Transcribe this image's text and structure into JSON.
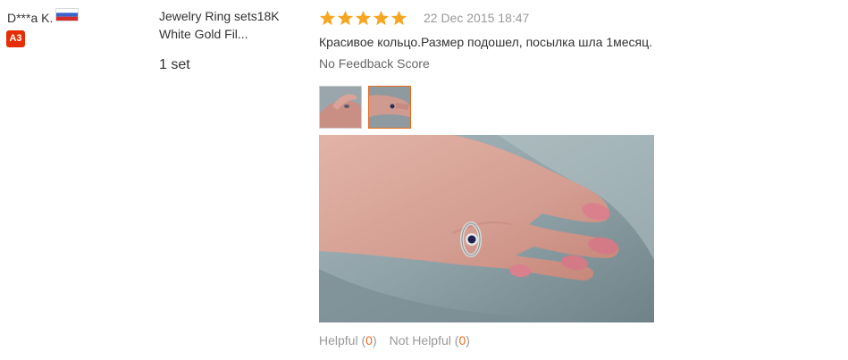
{
  "reviewer": {
    "name": "D***a K.",
    "country_flag": "russia-flag-icon",
    "level_badge": "A3",
    "badge_color": "#e62e04"
  },
  "product": {
    "title_line1": "Jewelry Ring sets18K",
    "title_line2": "White Gold Fil...",
    "quantity": "1 set"
  },
  "review": {
    "rating": 5,
    "rating_max": 5,
    "star_color": "#f5a623",
    "date": "22 Dec 2015 18:47",
    "text": "Красивое кольцо.Размер подошел, посылка шла 1месяц.",
    "feedback_score": "No Feedback Score"
  },
  "photos": {
    "thumbnails": [
      "review-photo-1",
      "review-photo-2"
    ],
    "active_index": 1
  },
  "votes": {
    "helpful_label": "Helpful",
    "helpful_open": "(",
    "helpful_count": "0",
    "helpful_close": ")",
    "not_helpful_label": "Not Helpful",
    "not_helpful_open": "(",
    "not_helpful_count": "0",
    "not_helpful_close": ")",
    "count_color": "#e86b1c"
  }
}
